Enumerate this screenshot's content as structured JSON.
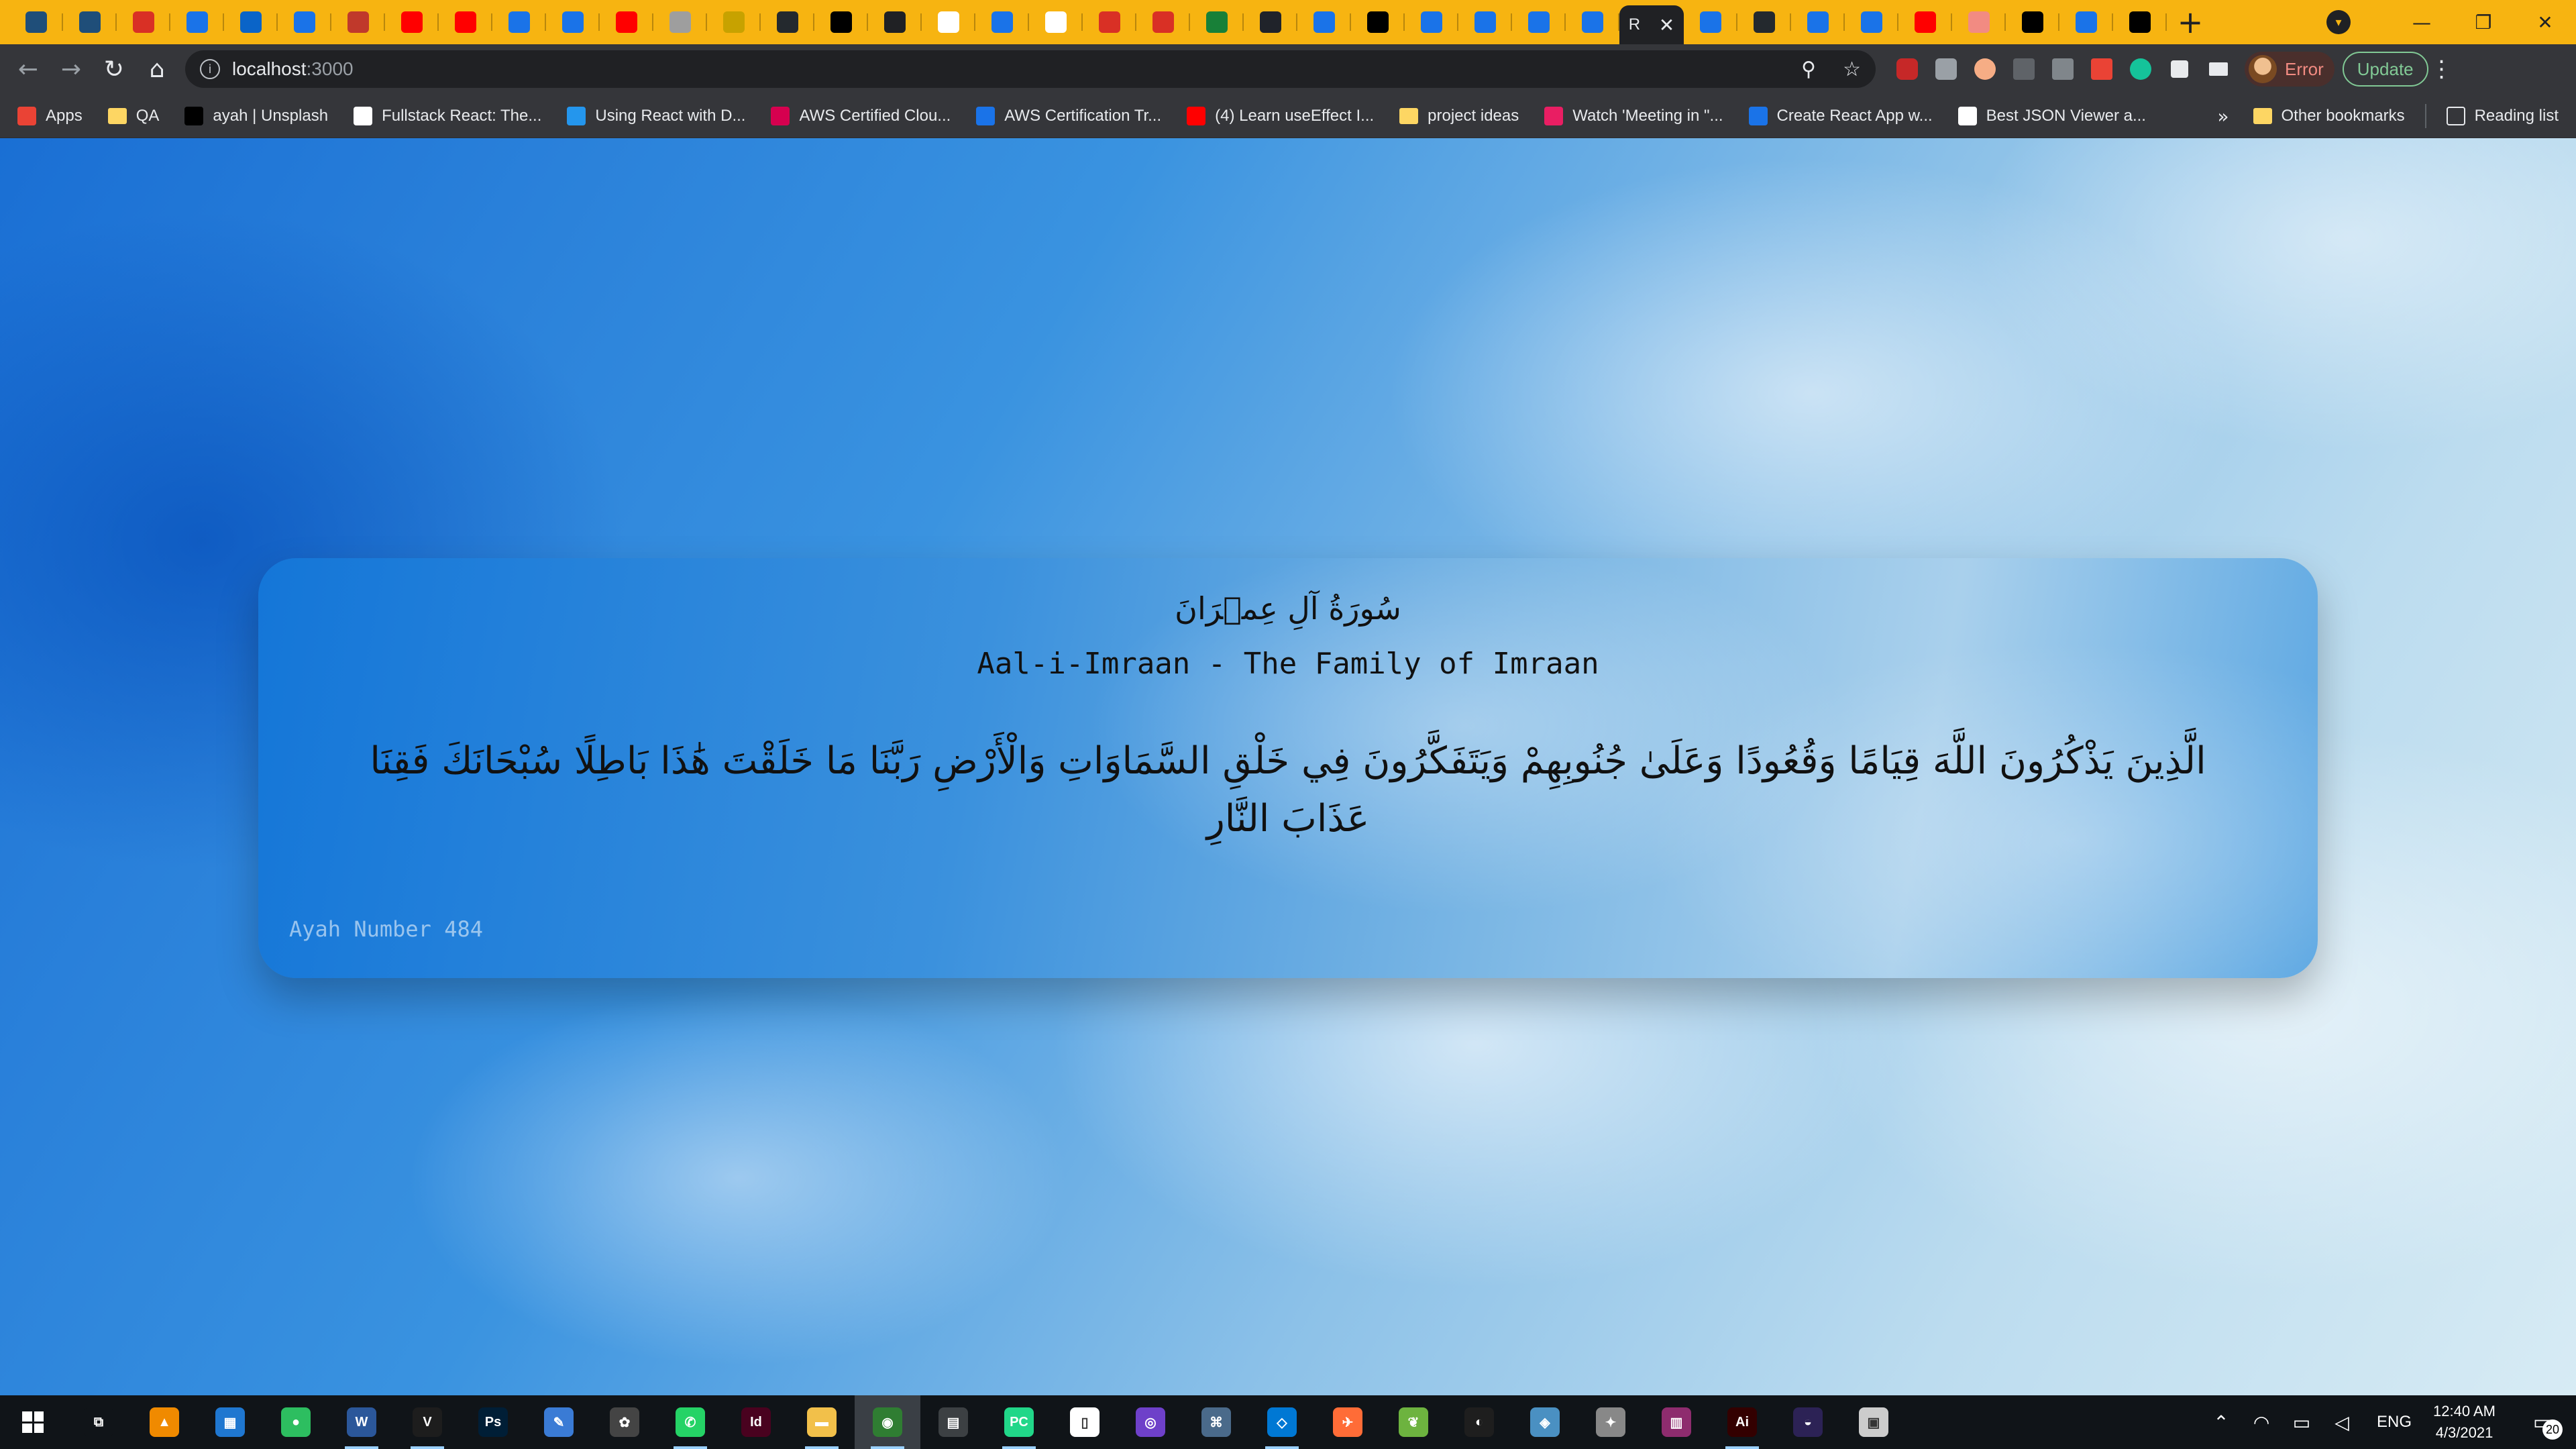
{
  "browser": {
    "tabs": [
      {
        "icon": "qa-icon",
        "color": "#1f4e79"
      },
      {
        "icon": "qa-icon",
        "color": "#1f4e79"
      },
      {
        "icon": "gmail-icon",
        "color": "#d93025"
      },
      {
        "icon": "wave-icon",
        "color": "#1a73e8"
      },
      {
        "icon": "outlook-icon",
        "color": "#0a64c8"
      },
      {
        "icon": "wave-icon",
        "color": "#1a73e8"
      },
      {
        "icon": "grid-icon",
        "color": "#c0392b"
      },
      {
        "icon": "youtube-icon",
        "color": "#ff0000"
      },
      {
        "icon": "youtube-icon",
        "color": "#ff0000"
      },
      {
        "icon": "wave-icon",
        "color": "#1a73e8"
      },
      {
        "icon": "wave-icon",
        "color": "#1a73e8"
      },
      {
        "icon": "youtube-icon",
        "color": "#ff0000"
      },
      {
        "icon": "globe-icon",
        "color": "#9e9e9e"
      },
      {
        "icon": "wave-icon",
        "color": "#c7a200"
      },
      {
        "icon": "github-user-icon",
        "color": "#24292e"
      },
      {
        "icon": "a-icon",
        "color": "#000000"
      },
      {
        "icon": "chatgpt-icon",
        "color": "#202124"
      },
      {
        "icon": "google-icon",
        "color": "#ffffff"
      },
      {
        "icon": "meet-icon",
        "color": "#1a73e8"
      },
      {
        "icon": "google-icon",
        "color": "#ffffff"
      },
      {
        "icon": "gmail-icon",
        "color": "#d93025"
      },
      {
        "icon": "gmail-icon",
        "color": "#d93025"
      },
      {
        "icon": "drive-icon",
        "color": "#188038"
      },
      {
        "icon": "react-icon",
        "color": "#20232a"
      },
      {
        "icon": "wave-icon",
        "color": "#1a73e8"
      },
      {
        "icon": "unsplash-icon",
        "color": "#000000"
      },
      {
        "icon": "wave-icon",
        "color": "#1a73e8"
      },
      {
        "icon": "wave-icon",
        "color": "#1a73e8"
      },
      {
        "icon": "wave-icon",
        "color": "#1a73e8"
      },
      {
        "icon": "wave-icon",
        "color": "#1a73e8"
      }
    ],
    "active_tab": {
      "label": "R",
      "close": "✕"
    },
    "tabs_after": [
      {
        "icon": "wave-icon",
        "color": "#1a73e8"
      },
      {
        "icon": "github-icon",
        "color": "#24292e"
      },
      {
        "icon": "wave-icon",
        "color": "#1a73e8"
      },
      {
        "icon": "wave-icon",
        "color": "#1a73e8"
      },
      {
        "icon": "youtube-icon",
        "color": "#ff0000"
      },
      {
        "icon": "hand-icon",
        "color": "#f28b82"
      },
      {
        "icon": "unsplash-icon",
        "color": "#000000"
      },
      {
        "icon": "wave-icon",
        "color": "#1a73e8"
      },
      {
        "icon": "chatgpt-icon",
        "color": "#000000"
      }
    ],
    "new_tab": "+",
    "window_controls": {
      "minimize": "—",
      "restore": "❐",
      "close": "✕"
    },
    "address": {
      "host": "localhost",
      "port": ":3000"
    },
    "profile_label": "Error",
    "update_label": "Update",
    "bookmarks": [
      {
        "label": "Apps",
        "icon": "apps-icon",
        "color": "#ea4335"
      },
      {
        "label": "QA",
        "icon": "folder-icon",
        "color": "#fdd663"
      },
      {
        "label": "ayah | Unsplash",
        "icon": "unsplash-icon",
        "color": "#000000"
      },
      {
        "label": "Fullstack React: The...",
        "icon": "w-icon",
        "color": "#ffffff"
      },
      {
        "label": "Using React with D...",
        "icon": "docker-icon",
        "color": "#2496ed"
      },
      {
        "label": "AWS Certified Clou...",
        "icon": "circle-icon",
        "color": "#d6004f"
      },
      {
        "label": "AWS Certification Tr...",
        "icon": "link-icon",
        "color": "#1a73e8"
      },
      {
        "label": "(4) Learn useEffect I...",
        "icon": "youtube-icon",
        "color": "#ff0000"
      },
      {
        "label": "project ideas",
        "icon": "folder-icon",
        "color": "#fdd663"
      },
      {
        "label": "Watch 'Meeting in \"...",
        "icon": "play-icon",
        "color": "#e91e63"
      },
      {
        "label": "Create React App w...",
        "icon": "wave-icon",
        "color": "#1a73e8"
      },
      {
        "label": "Best JSON Viewer a...",
        "icon": "cb-icon",
        "color": "#ffffff"
      }
    ],
    "bookmarks_overflow": "»",
    "other_bookmarks": "Other bookmarks",
    "reading_list": "Reading list"
  },
  "card": {
    "surah_arabic": "سُورَةُ آلِ عِمۡرَانَ",
    "surah_english": "Aal-i-Imraan - The Family of Imraan",
    "ayah_text": "الَّذِينَ يَذْكُرُونَ اللَّهَ قِيَامًا وَقُعُودًا وَعَلَىٰ جُنُوبِهِمْ وَيَتَفَكَّرُونَ فِي خَلْقِ السَّمَاوَاتِ وَالْأَرْضِ رَبَّنَا مَا خَلَقْتَ هَٰذَا بَاطِلًا سُبْحَانَكَ فَقِنَا عَذَابَ النَّارِ",
    "ayah_number_label": "Ayah Number 484"
  },
  "taskbar": {
    "apps": [
      {
        "icon": "task-view-icon",
        "color": "#101418",
        "glyph": "⧉"
      },
      {
        "icon": "vlc-icon",
        "color": "#f08a00",
        "glyph": "▲"
      },
      {
        "icon": "calendar-icon",
        "color": "#1f77d0",
        "glyph": "▦"
      },
      {
        "icon": "evernote-icon",
        "color": "#2dbe60",
        "glyph": "●"
      },
      {
        "icon": "word-icon",
        "color": "#2b579a",
        "glyph": "W"
      },
      {
        "icon": "visio-icon",
        "color": "#1d1d1d",
        "glyph": "V"
      },
      {
        "icon": "photoshop-icon",
        "color": "#001e36",
        "glyph": "Ps"
      },
      {
        "icon": "tool-icon",
        "color": "#3a7bd5",
        "glyph": "✎"
      },
      {
        "icon": "paint-icon",
        "color": "#444444",
        "glyph": "✿"
      },
      {
        "icon": "whatsapp-icon",
        "color": "#25d366",
        "glyph": "✆"
      },
      {
        "icon": "indesign-icon",
        "color": "#49021f",
        "glyph": "Id"
      },
      {
        "icon": "file-explorer-icon",
        "color": "#f2c04a",
        "glyph": "▬"
      },
      {
        "icon": "chrome-icon",
        "color": "#2f7d32",
        "glyph": "◉"
      },
      {
        "icon": "calculator-icon",
        "color": "#3c4043",
        "glyph": "▤"
      },
      {
        "icon": "pycharm-icon",
        "color": "#21d789",
        "glyph": "PC"
      },
      {
        "icon": "file-icon",
        "color": "#ffffff",
        "glyph": "▯"
      },
      {
        "icon": "github-desktop-icon",
        "color": "#6e40c9",
        "glyph": "◎"
      },
      {
        "icon": "sql-icon",
        "color": "#4a6a8a",
        "glyph": "⌘"
      },
      {
        "icon": "vscode-icon",
        "color": "#0078d4",
        "glyph": "◇"
      },
      {
        "icon": "postman-icon",
        "color": "#ff6c37",
        "glyph": "✈"
      },
      {
        "icon": "spring-icon",
        "color": "#6db33f",
        "glyph": "❦"
      },
      {
        "icon": "figma-icon",
        "color": "#1e1e1e",
        "glyph": "◐"
      },
      {
        "icon": "notes-icon",
        "color": "#4a90c2",
        "glyph": "◈"
      },
      {
        "icon": "paint3d-icon",
        "color": "#888888",
        "glyph": "✦"
      },
      {
        "icon": "winrar-icon",
        "color": "#8e2c6e",
        "glyph": "▥"
      },
      {
        "icon": "illustrator-icon",
        "color": "#330000",
        "glyph": "Ai"
      },
      {
        "icon": "eclipse-icon",
        "color": "#2c2255",
        "glyph": "◒"
      },
      {
        "icon": "monitor-icon",
        "color": "#cccccc",
        "glyph": "▣"
      }
    ],
    "language": "ENG",
    "time": "12:40 AM",
    "date": "4/3/2021",
    "notification_count": "20"
  }
}
